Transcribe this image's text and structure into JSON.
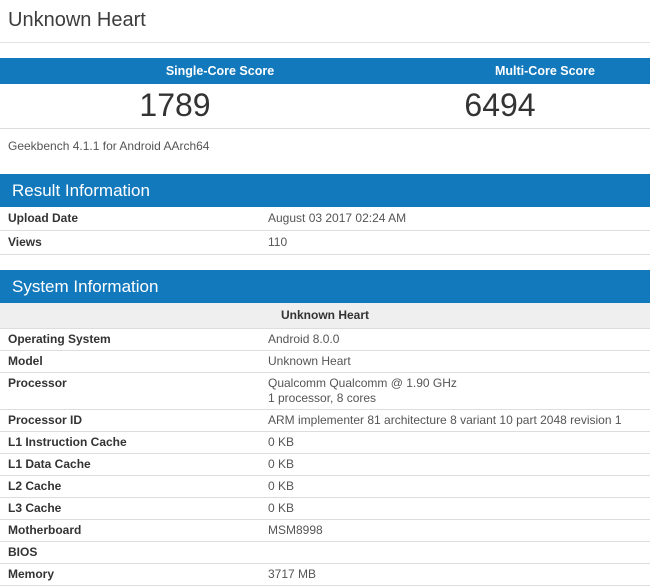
{
  "page": {
    "title": "Unknown Heart"
  },
  "scores": {
    "single_core": {
      "label": "Single-Core Score",
      "value": "1789"
    },
    "multi_core": {
      "label": "Multi-Core Score",
      "value": "6494"
    },
    "footnote": "Geekbench 4.1.1 for Android AArch64"
  },
  "result_information": {
    "heading": "Result Information",
    "rows": [
      {
        "label": "Upload Date",
        "value": "August 03 2017 02:24 AM"
      },
      {
        "label": "Views",
        "value": "110"
      }
    ]
  },
  "system_information": {
    "heading": "System Information",
    "device_name": "Unknown Heart",
    "rows": [
      {
        "label": "Operating System",
        "value": "Android 8.0.0"
      },
      {
        "label": "Model",
        "value": "Unknown Heart"
      },
      {
        "label": "Processor",
        "value": "Qualcomm Qualcomm @ 1.90 GHz",
        "value2": "1 processor, 8 cores"
      },
      {
        "label": "Processor ID",
        "value": "ARM implementer 81 architecture 8 variant 10 part 2048 revision 1"
      },
      {
        "label": "L1 Instruction Cache",
        "value": "0 KB"
      },
      {
        "label": "L1 Data Cache",
        "value": "0 KB"
      },
      {
        "label": "L2 Cache",
        "value": "0 KB"
      },
      {
        "label": "L3 Cache",
        "value": "0 KB"
      },
      {
        "label": "Motherboard",
        "value": "MSM8998"
      },
      {
        "label": "BIOS",
        "value": ""
      },
      {
        "label": "Memory",
        "value": "3717 MB"
      }
    ]
  },
  "colors": {
    "accent_blue": "#1279bd",
    "subheader_bg": "#efefef",
    "row_border": "#dddddd"
  }
}
